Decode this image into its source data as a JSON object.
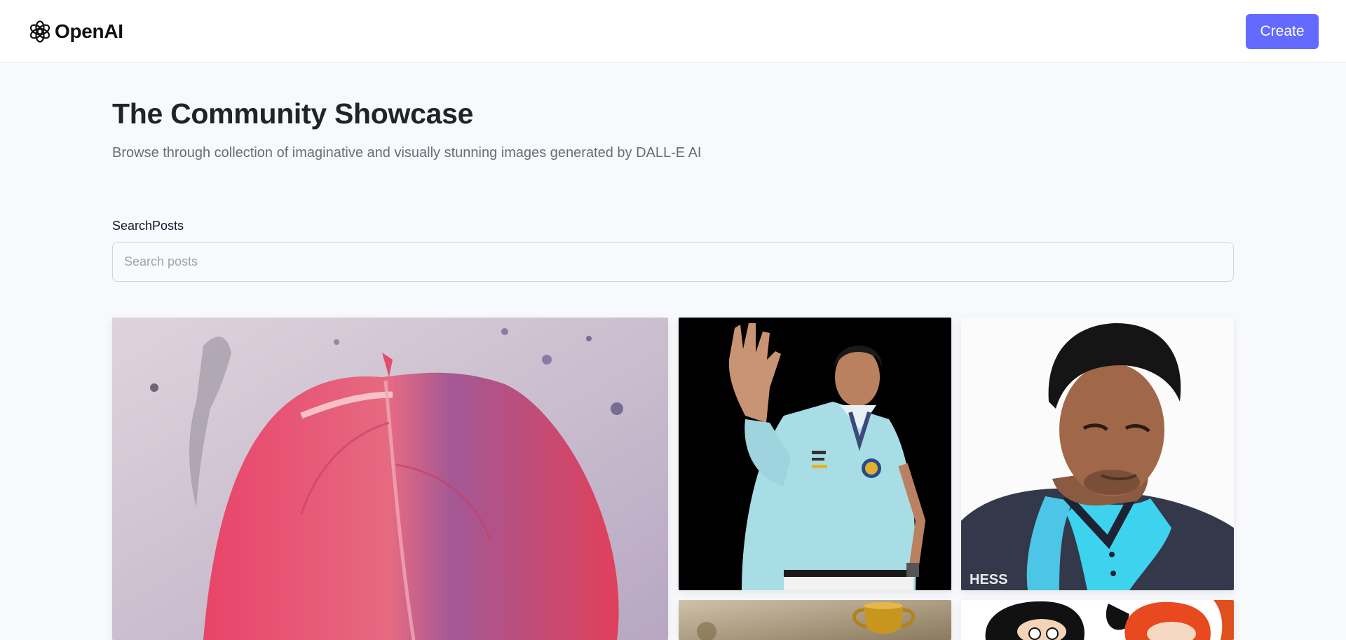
{
  "header": {
    "brand": "OpenAI",
    "create_label": "Create"
  },
  "hero": {
    "title": "The Community Showcase",
    "subtitle": "Browse through collection of imaginative and visually stunning images generated by DALL-E AI"
  },
  "search": {
    "label": "SearchPosts",
    "placeholder": "Search posts",
    "value": ""
  },
  "gallery": {
    "posts": [
      {
        "subject": "red leaf painting"
      },
      {
        "subject": "man waving in sports shirt"
      },
      {
        "subject": "man in polo shirt portrait"
      },
      {
        "subject": "trophy"
      },
      {
        "subject": "cartoon characters"
      }
    ]
  },
  "colors": {
    "accent": "#6469ff",
    "background": "#f8f9fc",
    "title": "#222328",
    "subtitle": "#666e75"
  }
}
